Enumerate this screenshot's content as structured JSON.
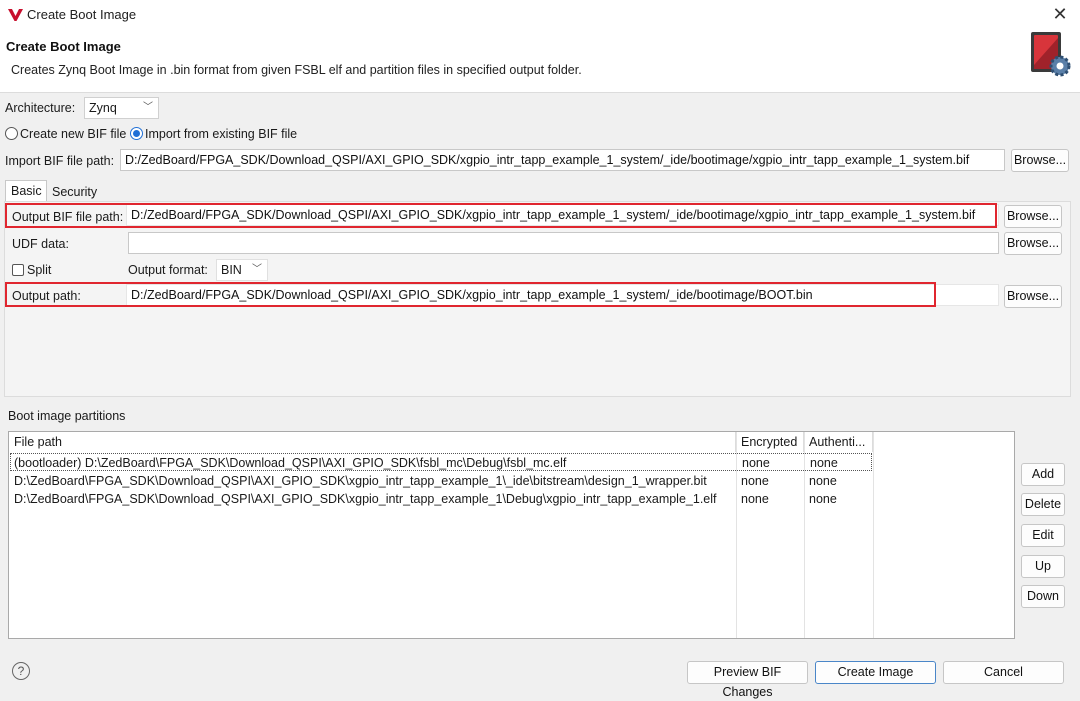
{
  "window": {
    "title": "Create Boot Image",
    "close_glyph": "✕"
  },
  "header": {
    "title": "Create Boot Image",
    "description": "Creates Zynq Boot Image in .bin format from given FSBL elf and partition files in specified output folder.",
    "icon": "boot-image-gear-icon"
  },
  "architecture": {
    "label": "Architecture:",
    "value": "Zynq"
  },
  "bif_mode": {
    "create_label": "Create new BIF file",
    "import_label": "Import from existing BIF file",
    "selected": "import"
  },
  "import_bif": {
    "label": "Import BIF file path:",
    "value": "D:/ZedBoard/FPGA_SDK/Download_QSPI/AXI_GPIO_SDK/xgpio_intr_tapp_example_1_system/_ide/bootimage/xgpio_intr_tapp_example_1_system.bif",
    "browse": "Browse..."
  },
  "tabs": [
    {
      "label": "Basic"
    },
    {
      "label": "Security"
    }
  ],
  "output_bif": {
    "label": "Output BIF file path:",
    "value": "D:/ZedBoard/FPGA_SDK/Download_QSPI/AXI_GPIO_SDK/xgpio_intr_tapp_example_1_system/_ide/bootimage/xgpio_intr_tapp_example_1_system.bif",
    "browse": "Browse..."
  },
  "udf": {
    "label": "UDF data:",
    "value": "",
    "browse": "Browse..."
  },
  "split": {
    "label": "Split",
    "checked": false
  },
  "output_format": {
    "label": "Output format:",
    "value": "BIN"
  },
  "output_path": {
    "label": "Output path:",
    "value": "D:/ZedBoard/FPGA_SDK/Download_QSPI/AXI_GPIO_SDK/xgpio_intr_tapp_example_1_system/_ide/bootimage/BOOT.bin",
    "browse": "Browse..."
  },
  "partitions": {
    "label": "Boot image partitions",
    "columns": [
      "File path",
      "Encrypted",
      "Authenti..."
    ],
    "rows": [
      {
        "path": "(bootloader) D:\\ZedBoard\\FPGA_SDK\\Download_QSPI\\AXI_GPIO_SDK\\fsbl_mc\\Debug\\fsbl_mc.elf",
        "encrypted": "none",
        "auth": "none"
      },
      {
        "path": "D:\\ZedBoard\\FPGA_SDK\\Download_QSPI\\AXI_GPIO_SDK\\xgpio_intr_tapp_example_1\\_ide\\bitstream\\design_1_wrapper.bit",
        "encrypted": "none",
        "auth": "none"
      },
      {
        "path": "D:\\ZedBoard\\FPGA_SDK\\Download_QSPI\\AXI_GPIO_SDK\\xgpio_intr_tapp_example_1\\Debug\\xgpio_intr_tapp_example_1.elf",
        "encrypted": "none",
        "auth": "none"
      }
    ],
    "buttons": {
      "add": "Add",
      "delete": "Delete",
      "edit": "Edit",
      "up": "Up",
      "down": "Down"
    }
  },
  "footer": {
    "help": "?",
    "preview": "Preview BIF Changes",
    "create": "Create Image",
    "cancel": "Cancel"
  },
  "colors": {
    "highlight_box": "#e0262f",
    "radio_selected": "#1f6fd6",
    "primary_border": "#4a86c8"
  }
}
